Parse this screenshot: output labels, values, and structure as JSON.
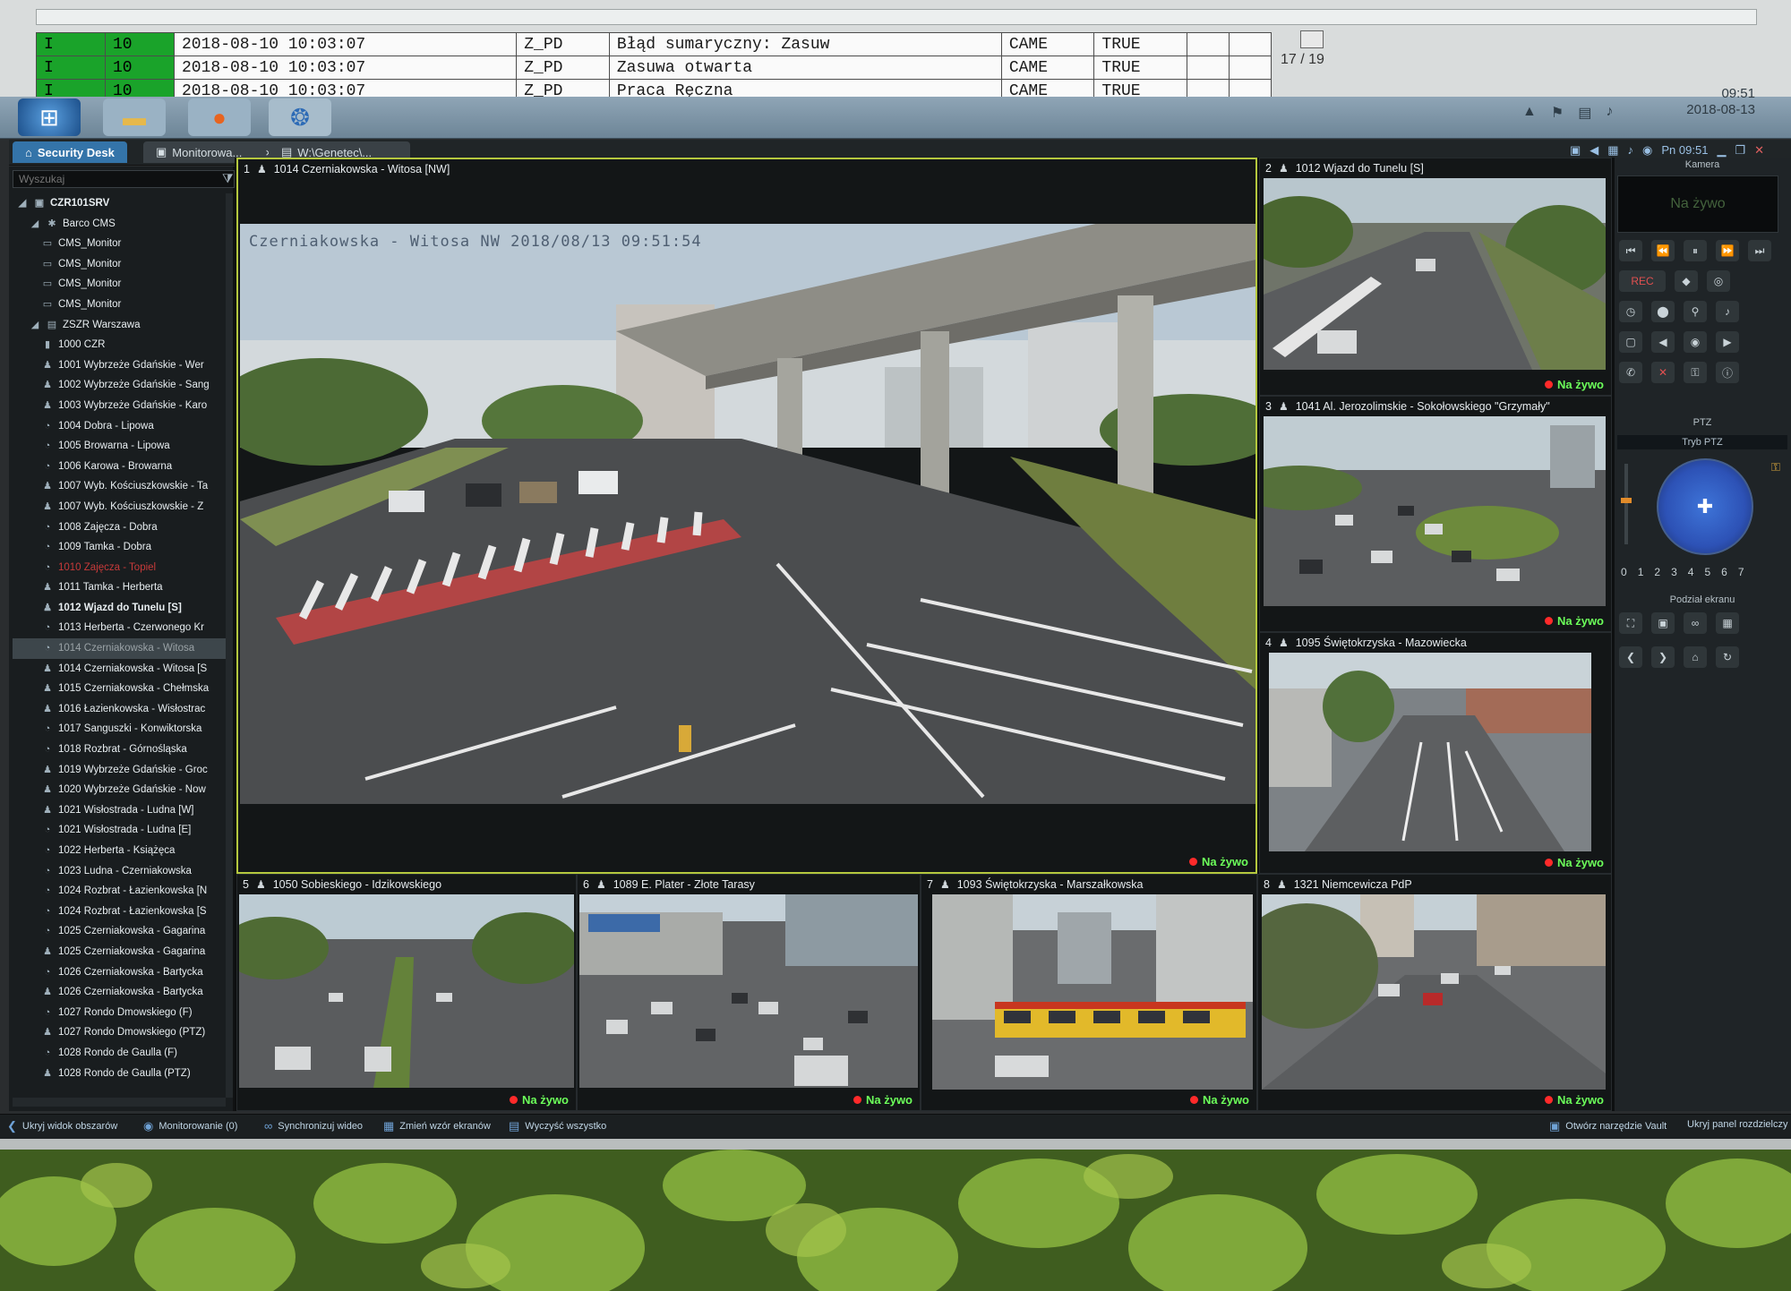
{
  "log": {
    "rows": [
      {
        "level": "I",
        "priority": "10",
        "timestamp": "2018-08-10 10:03:07",
        "zone": "Z_PD",
        "message": "Błąd sumaryczny: Zasuw",
        "source": "CAME",
        "value": "TRUE"
      },
      {
        "level": "I",
        "priority": "10",
        "timestamp": "2018-08-10 10:03:07",
        "zone": "Z_PD",
        "message": "Zasuwa otwarta",
        "source": "CAME",
        "value": "TRUE"
      },
      {
        "level": "I",
        "priority": "10",
        "timestamp": "2018-08-10 10:03:07",
        "zone": "Z_PD",
        "message": "Praca Ręczna",
        "source": "CAME",
        "value": "TRUE"
      }
    ],
    "pager": "17 / 19"
  },
  "os_taskbar": {
    "clock_time": "09:51",
    "clock_date": "2018-08-13"
  },
  "app": {
    "tabs": [
      {
        "label": "Security Desk"
      },
      {
        "label": "Monitorowa..."
      },
      {
        "label": "W:\\Genetec\\..."
      }
    ],
    "header_time": "Pn 09:51"
  },
  "sidebar": {
    "search_placeholder": "Wyszukaj",
    "tree": [
      {
        "label": "CZR101SRV",
        "icon": "server-icon",
        "indent": 0,
        "bold": true
      },
      {
        "label": "Barco CMS",
        "icon": "group-icon",
        "indent": 1
      },
      {
        "label": "CMS_Monitor",
        "icon": "monitor-icon",
        "indent": 2
      },
      {
        "label": "CMS_Monitor",
        "icon": "monitor-icon",
        "indent": 2
      },
      {
        "label": "CMS_Monitor",
        "icon": "monitor-icon",
        "indent": 2
      },
      {
        "label": "CMS_Monitor",
        "icon": "monitor-icon",
        "indent": 2
      },
      {
        "label": "ZSZR Warszawa",
        "icon": "area-icon",
        "indent": 1
      },
      {
        "label": "1000 CZR",
        "icon": "device-icon",
        "indent": 2
      },
      {
        "label": "1001 Wybrzeże Gdańskie - Wer",
        "icon": "ptz-camera-icon",
        "indent": 2
      },
      {
        "label": "1002 Wybrzeże Gdańskie - Sang",
        "icon": "ptz-camera-icon",
        "indent": 2
      },
      {
        "label": "1003 Wybrzeże Gdańskie - Karo",
        "icon": "ptz-camera-icon",
        "indent": 2
      },
      {
        "label": "1004 Dobra - Lipowa",
        "icon": "camera-icon",
        "indent": 2
      },
      {
        "label": "1005 Browarna - Lipowa",
        "icon": "camera-icon",
        "indent": 2
      },
      {
        "label": "1006 Karowa - Browarna",
        "icon": "camera-icon",
        "indent": 2
      },
      {
        "label": "1007 Wyb. Kościuszkowskie - Ta",
        "icon": "ptz-camera-icon",
        "indent": 2
      },
      {
        "label": "1007 Wyb. Kościuszkowskie - Z",
        "icon": "ptz-camera-icon",
        "indent": 2
      },
      {
        "label": "1008 Zajęcza - Dobra",
        "icon": "camera-icon",
        "indent": 2
      },
      {
        "label": "1009 Tamka - Dobra",
        "icon": "camera-icon",
        "indent": 2
      },
      {
        "label": "1010 Zajęcza - Topiel",
        "icon": "camera-icon",
        "indent": 2,
        "state": "offline"
      },
      {
        "label": "1011 Tamka - Herberta",
        "icon": "ptz-camera-icon",
        "indent": 2
      },
      {
        "label": "1012 Wjazd do Tunelu [S]",
        "icon": "ptz-camera-icon",
        "indent": 2,
        "bold": true
      },
      {
        "label": "1013 Herberta - Czerwonego Kr",
        "icon": "camera-icon",
        "indent": 2
      },
      {
        "label": "1014 Czerniakowska - Witosa",
        "icon": "camera-icon",
        "indent": 2,
        "state": "selected"
      },
      {
        "label": "1014 Czerniakowska - Witosa [S",
        "icon": "ptz-camera-icon",
        "indent": 2
      },
      {
        "label": "1015 Czerniakowska - Chełmska",
        "icon": "ptz-camera-icon",
        "indent": 2
      },
      {
        "label": "1016 Łazienkowska - Wisłostrac",
        "icon": "ptz-camera-icon",
        "indent": 2
      },
      {
        "label": "1017 Sanguszki - Konwiktorska",
        "icon": "camera-icon",
        "indent": 2
      },
      {
        "label": "1018 Rozbrat - Górnośląska",
        "icon": "camera-icon",
        "indent": 2
      },
      {
        "label": "1019 Wybrzeże Gdańskie - Groc",
        "icon": "ptz-camera-icon",
        "indent": 2
      },
      {
        "label": "1020 Wybrzeże Gdańskie - Now",
        "icon": "ptz-camera-icon",
        "indent": 2
      },
      {
        "label": "1021 Wisłostrada - Ludna [W]",
        "icon": "ptz-camera-icon",
        "indent": 2
      },
      {
        "label": "1021 Wisłostrada - Ludna [E]",
        "icon": "camera-icon",
        "indent": 2
      },
      {
        "label": "1022 Herberta - Książęca",
        "icon": "camera-icon",
        "indent": 2
      },
      {
        "label": "1023 Ludna - Czerniakowska",
        "icon": "camera-icon",
        "indent": 2
      },
      {
        "label": "1024 Rozbrat - Łazienkowska [N",
        "icon": "camera-icon",
        "indent": 2
      },
      {
        "label": "1024 Rozbrat - Łazienkowska [S",
        "icon": "camera-icon",
        "indent": 2
      },
      {
        "label": "1025 Czerniakowska - Gagarina",
        "icon": "camera-icon",
        "indent": 2
      },
      {
        "label": "1025 Czerniakowska - Gagarina",
        "icon": "ptz-camera-icon",
        "indent": 2
      },
      {
        "label": "1026 Czerniakowska - Bartycka",
        "icon": "camera-icon",
        "indent": 2
      },
      {
        "label": "1026 Czerniakowska - Bartycka",
        "icon": "ptz-camera-icon",
        "indent": 2
      },
      {
        "label": "1027 Rondo Dmowskiego (F)",
        "icon": "camera-icon",
        "indent": 2
      },
      {
        "label": "1027 Rondo Dmowskiego (PTZ)",
        "icon": "ptz-camera-icon",
        "indent": 2
      },
      {
        "label": "1028 Rondo de Gaulla (F)",
        "icon": "camera-icon",
        "indent": 2
      },
      {
        "label": "1028 Rondo de Gaulla (PTZ)",
        "icon": "ptz-camera-icon",
        "indent": 2
      }
    ]
  },
  "tiles": [
    {
      "num": "1",
      "name": "1014 Czerniakowska - Witosa [NW]",
      "overlay": "Czerniakowska - Witosa NW 2018/08/13 09:51:54",
      "status": "Na żywo"
    },
    {
      "num": "2",
      "name": "1012 Wjazd do Tunelu [S]",
      "status": "Na żywo"
    },
    {
      "num": "3",
      "name": "1041 Al. Jerozolimskie - Sokołowskiego \"Grzymały\"",
      "status": "Na żywo"
    },
    {
      "num": "4",
      "name": "1095 Świętokrzyska - Mazowiecka",
      "status": "Na żywo"
    },
    {
      "num": "5",
      "name": "1050 Sobieskiego - Idzikowskiego",
      "status": "Na żywo"
    },
    {
      "num": "6",
      "name": "1089 E. Plater - Złote Tarasy",
      "status": "Na żywo"
    },
    {
      "num": "7",
      "name": "1093 Świętokrzyska - Marszałkowska",
      "status": "Na żywo"
    },
    {
      "num": "8",
      "name": "1321 Niemcewicza PdP",
      "status": "Na żywo"
    }
  ],
  "controls": {
    "camera_title": "Kamera",
    "camera_status": "Na żywo",
    "rec_label": "REC",
    "ptz_title": "PTZ",
    "ptz_mode": "Tryb PTZ",
    "presets": [
      "0",
      "1",
      "2",
      "3",
      "4",
      "5",
      "6",
      "7"
    ],
    "screen_split_title": "Podział ekranu"
  },
  "bottom_bar": {
    "hide_area_view": "Ukryj widok obszarów",
    "monitoring": "Monitorowanie (0)",
    "sync_video": "Synchronizuj wideo",
    "change_pattern": "Zmień wzór ekranów",
    "clear_all": "Wyczyść wszystko",
    "open_vault": "Otwórz narzędzie Vault",
    "hide_panel": "Ukryj panel rozdzielczy"
  },
  "colors": {
    "live_text": "#6cff5a",
    "live_dot": "#ff2a2a",
    "active_tile_border": "#b5c83e",
    "tab_active": "#3474a9",
    "log_level_bg": "#1aa32a"
  }
}
